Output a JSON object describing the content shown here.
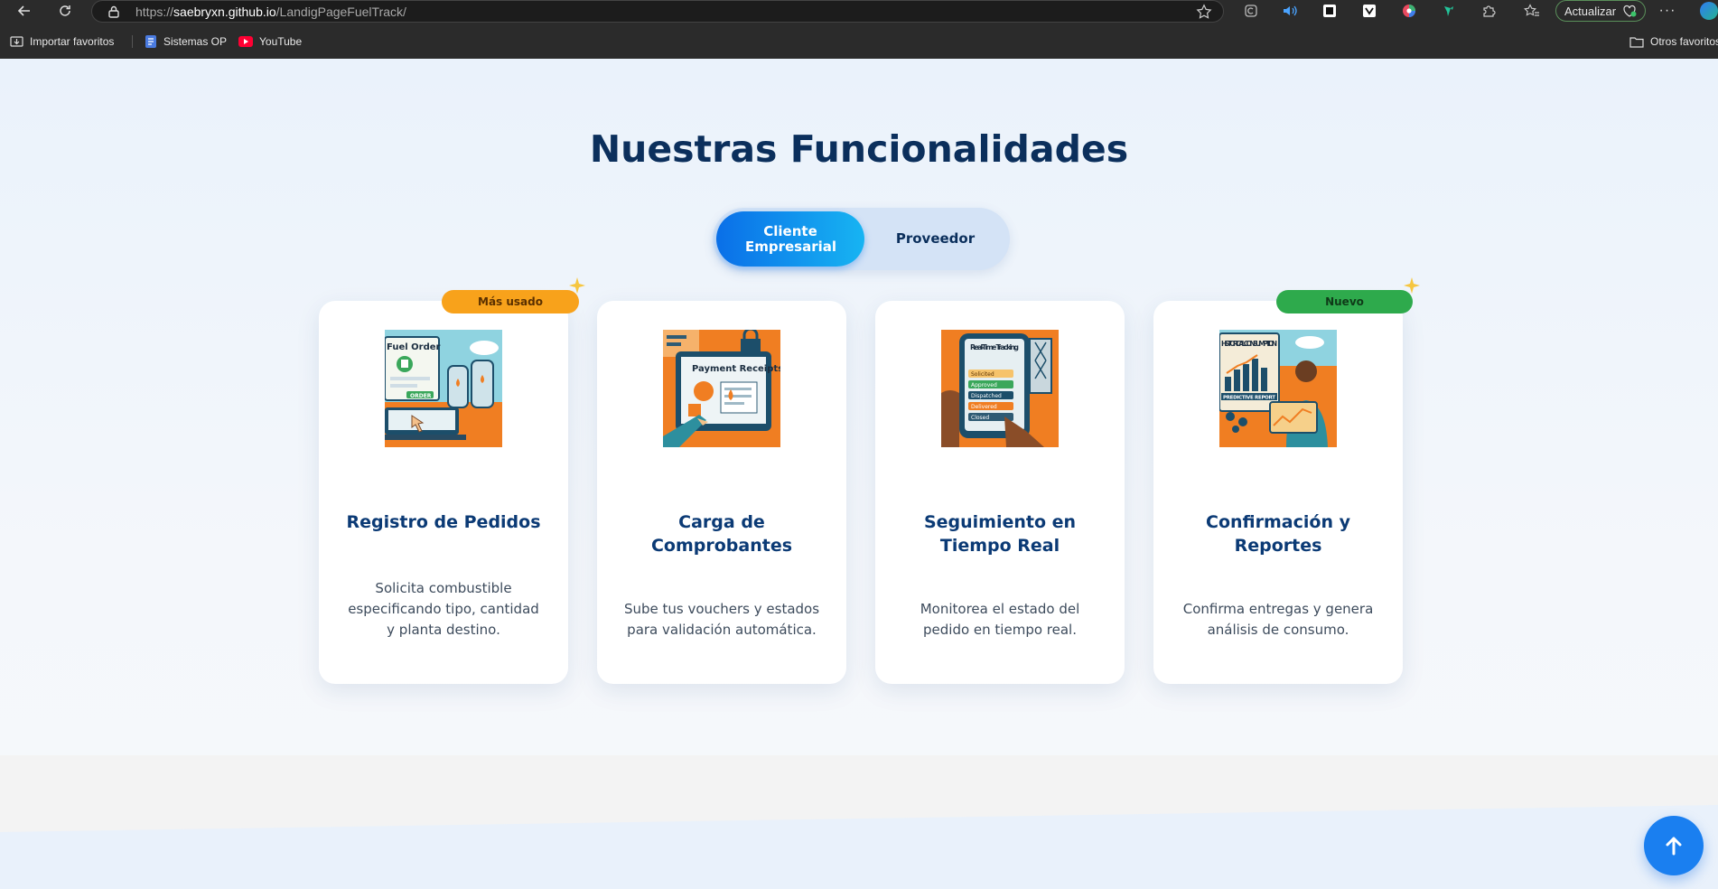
{
  "browser": {
    "url_scheme": "https://",
    "url_host": "saebryxn.github.io",
    "url_path": "/LandigPageFuelTrack/",
    "update_label": "Actualizar",
    "bookmarks": [
      {
        "label": "Importar favoritos",
        "icon": "import-icon"
      },
      {
        "label": "Sistemas OP",
        "icon": "doc-icon"
      },
      {
        "label": "YouTube",
        "icon": "youtube-icon"
      }
    ],
    "other_bookmarks": "Otros favoritos"
  },
  "page": {
    "title": "Nuestras Funcionalidades",
    "toggle": {
      "active_label": "Cliente Empresarial",
      "inactive_label": "Proveedor"
    },
    "cards": [
      {
        "badge": "Más usado",
        "title": "Registro de Pedidos",
        "description": "Solicita combustible especificando tipo, cantidad y planta destino.",
        "image_text": [
          "Fuel Order",
          "ORDER"
        ]
      },
      {
        "title": "Carga de Comprobantes",
        "description": "Sube tus vouchers y estados para validación automática.",
        "image_text": [
          "Payment Receipts"
        ]
      },
      {
        "title": "Seguimiento en Tiempo Real",
        "description": "Monitorea el estado del pedido en tiempo real.",
        "image_text": [
          "Real-Time Tracking",
          "Solicited",
          "Approved",
          "Dispatched",
          "Delivered",
          "Closed"
        ]
      },
      {
        "badge": "Nuevo",
        "title": "Confirmación y Reportes",
        "description": "Confirma entregas y genera análisis de consumo.",
        "image_text": [
          "HISTORICAL CONSUMPTION",
          "PREDICTIVE REPORT"
        ]
      }
    ]
  },
  "colors": {
    "title": "#0b2f5c",
    "accent": "#1677e6",
    "badge_orange": "#f8a21b",
    "badge_green": "#2eaa4c"
  }
}
